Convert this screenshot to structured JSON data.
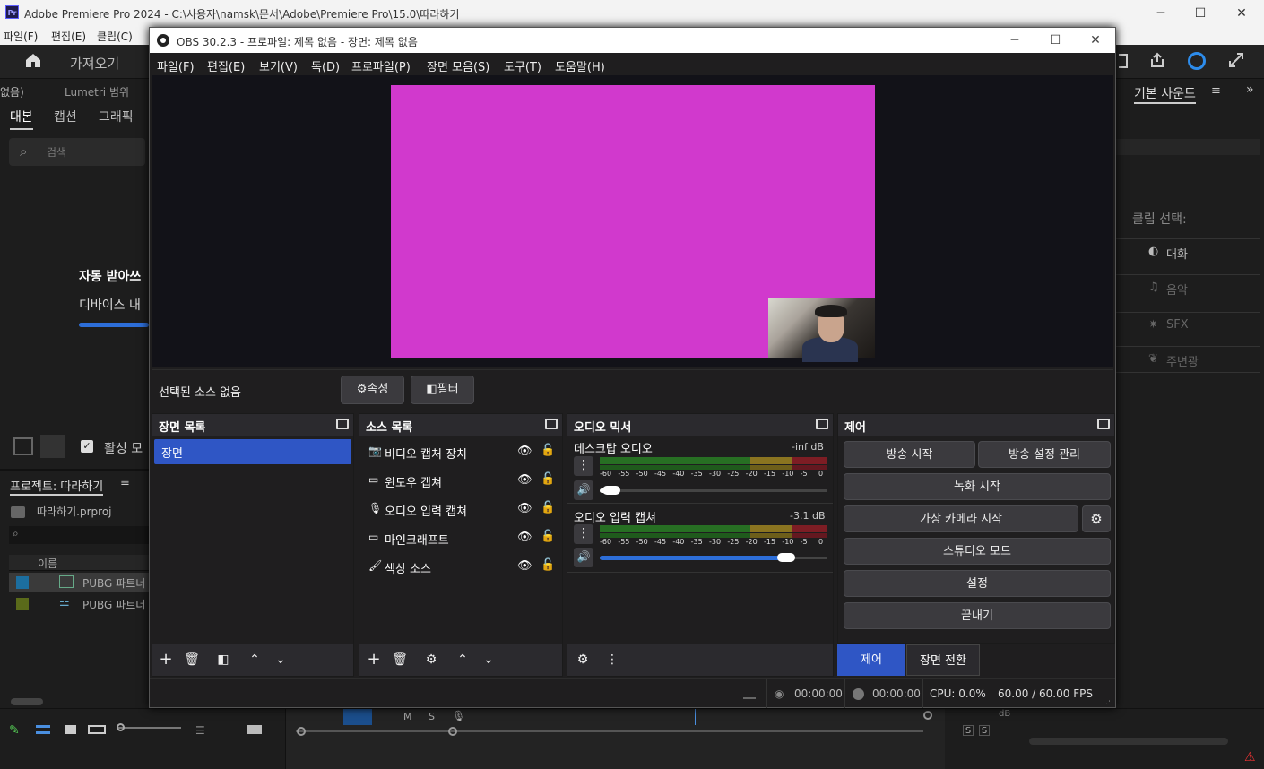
{
  "premiere": {
    "title": "Adobe Premiere Pro 2024 - C:\\사용자\\namsk\\문서\\Adobe\\Premiere Pro\\15.0\\따라하기",
    "logo": "Pr",
    "menu": [
      "파일(F)",
      "편집(E)",
      "클립(C)"
    ],
    "topbar": {
      "home_icon": "home-icon",
      "import_label": "가져오기"
    },
    "left": {
      "panel_tabs_top": [
        "없음)",
        "Lumetri 범위"
      ],
      "tabs": [
        "대본",
        "캡션",
        "그래픽"
      ],
      "search_placeholder": "검색",
      "auto_transcribe": "자동 받아쓰",
      "device_text": "디바이스 내",
      "active_label": "활성 모",
      "progress": 1.0
    },
    "project": {
      "tab": "프로젝트: 따라하기",
      "file": "따라하기.prproj",
      "col_name": "이름",
      "items": [
        {
          "name": "PUBG 파트너",
          "color": "#1c6e9f"
        },
        {
          "name": "PUBG 파트너",
          "color": "#5a6a1a"
        }
      ]
    },
    "right": {
      "tab": "기본 사운드",
      "clip_select": "클립 선택:",
      "items": [
        "대화",
        "음악",
        "SFX",
        "주변광"
      ]
    },
    "bottom": {
      "track_labels": [
        "M",
        "S"
      ],
      "db": "dB",
      "s1": "S",
      "s2": "S"
    }
  },
  "obs": {
    "title": "OBS 30.2.3 - 프로파일: 제목 없음 - 장면: 제목 없음",
    "menu": [
      "파일(F)",
      "편집(E)",
      "보기(V)",
      "독(D)",
      "프로파일(P)",
      "장면 모음(S)",
      "도구(T)",
      "도움말(H)"
    ],
    "no_source": "선택된 소스 없음",
    "properties": "속성",
    "filters": "필터",
    "scenes": {
      "title": "장면 목록",
      "items": [
        "장면"
      ]
    },
    "sources": {
      "title": "소스 목록",
      "items": [
        {
          "label": "비디오 캡처 장치",
          "icon": "camera-icon"
        },
        {
          "label": "윈도우 캡쳐",
          "icon": "window-icon"
        },
        {
          "label": "오디오 입력 캡쳐",
          "icon": "microphone-icon"
        },
        {
          "label": "마인크래프트",
          "icon": "window-icon"
        },
        {
          "label": "색상 소스",
          "icon": "brush-icon"
        }
      ]
    },
    "mixer": {
      "title": "오디오 믹서",
      "channels": [
        {
          "name": "데스크탑 오디오",
          "level": "-inf dB",
          "volume": 0.05
        },
        {
          "name": "오디오 입력 캡쳐",
          "level": "-3.1 dB",
          "volume": 0.82
        }
      ],
      "ticks": [
        "-60",
        "-55",
        "-50",
        "-45",
        "-40",
        "-35",
        "-30",
        "-25",
        "-20",
        "-15",
        "-10",
        "-5",
        "0"
      ]
    },
    "controls": {
      "title": "제어",
      "start_stream": "방송 시작",
      "stream_settings": "방송 설정 관리",
      "start_record": "녹화 시작",
      "virtual_cam": "가상 카메라 시작",
      "studio_mode": "스튜디오 모드",
      "settings": "설정",
      "exit": "끝내기",
      "tab_controls": "제어",
      "tab_transitions": "장면 전환"
    },
    "status": {
      "stream_time": "00:00:00",
      "record_time": "00:00:00",
      "cpu": "CPU: 0.0%",
      "fps": "60.00 / 60.00 FPS"
    }
  }
}
